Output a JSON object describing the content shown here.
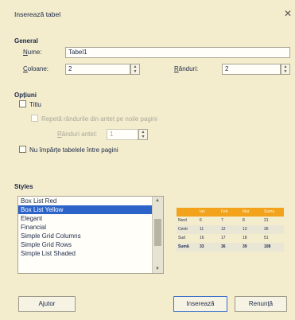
{
  "window": {
    "title": "Inserează tabel"
  },
  "general": {
    "heading": "General",
    "name_label_u": "N",
    "name_label_rest": "ume:",
    "name_value": "Tabel1",
    "columns_label_u": "C",
    "columns_label_rest": "oloane:",
    "columns_value": "2",
    "rows_label_u": "R",
    "rows_label_rest": "ânduri:",
    "rows_value": "2"
  },
  "options": {
    "heading": "Opțiuni",
    "heading_checkbox_label": "Titlu",
    "repeat_header_label": "Repetă rândurile din antet pe noile pagini",
    "header_rows_label_u": "R",
    "header_rows_label_rest": "ânduri antet:",
    "header_rows_value": "1",
    "dont_split_label": "Nu împărțe tabelele între pagini"
  },
  "styles": {
    "heading": "Styles",
    "items": [
      "Box List Red",
      "Box List Yellow",
      "Elegant",
      "Financial",
      "Simple Grid Columns",
      "Simple Grid Rows",
      "Simple List Shaded"
    ],
    "selected_index": 1
  },
  "preview": {
    "header": [
      "",
      "Ian",
      "Feb",
      "Mar",
      "Suma"
    ],
    "rows": [
      [
        "Nord",
        "6",
        "7",
        "8",
        "21"
      ],
      [
        "Centr",
        "11",
        "12",
        "13",
        "36"
      ],
      [
        "Sud",
        "16",
        "17",
        "18",
        "51"
      ],
      [
        "Sumă",
        "33",
        "36",
        "39",
        "108"
      ]
    ],
    "accent_color": "#f2a21b"
  },
  "buttons": {
    "help": "Ajutor",
    "insert": "Inserează",
    "cancel": "Renunță"
  }
}
